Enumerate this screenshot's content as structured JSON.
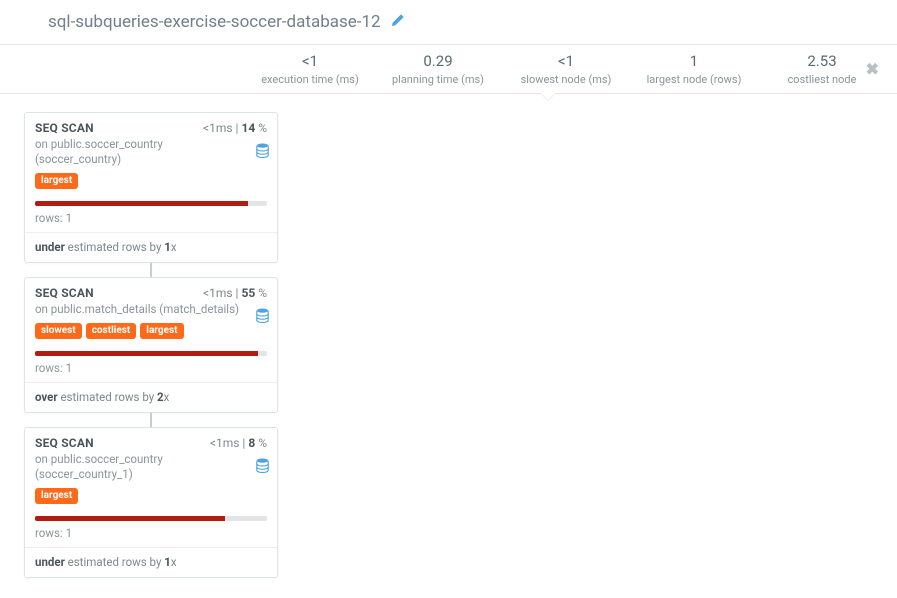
{
  "title": "sql-subqueries-exercise-soccer-database-12",
  "stats": [
    {
      "value": "<1",
      "label": "execution time (ms)"
    },
    {
      "value": "0.29",
      "label": "planning time (ms)"
    },
    {
      "value": "<1",
      "label": "slowest node (ms)"
    },
    {
      "value": "1",
      "label": "largest node (rows)"
    },
    {
      "value": "2.53",
      "label": "costliest node"
    }
  ],
  "nodes": [
    {
      "type": "SEQ SCAN",
      "time": "<1",
      "time_unit": "ms",
      "pct": "14",
      "on_prefix": "on ",
      "on": "public.soccer_country (soccer_country)",
      "badges": [
        "largest"
      ],
      "bar_pct": 92,
      "rows_label": "rows: ",
      "rows": "1",
      "est_dir": "under",
      "est_mid": " estimated rows by ",
      "est_x": "1",
      "est_suffix": "x"
    },
    {
      "type": "SEQ SCAN",
      "time": "<1",
      "time_unit": "ms",
      "pct": "55",
      "on_prefix": "on ",
      "on": "public.match_details (match_details)",
      "badges": [
        "slowest",
        "costliest",
        "largest"
      ],
      "bar_pct": 96,
      "rows_label": "rows: ",
      "rows": "1",
      "est_dir": "over",
      "est_mid": " estimated rows by ",
      "est_x": "2",
      "est_suffix": "x"
    },
    {
      "type": "SEQ SCAN",
      "time": "<1",
      "time_unit": "ms",
      "pct": "8",
      "on_prefix": "on ",
      "on": "public.soccer_country (soccer_country_1)",
      "badges": [
        "largest"
      ],
      "bar_pct": 82,
      "rows_label": "rows: ",
      "rows": "1",
      "est_dir": "under",
      "est_mid": " estimated rows by ",
      "est_x": "1",
      "est_suffix": "x"
    }
  ]
}
